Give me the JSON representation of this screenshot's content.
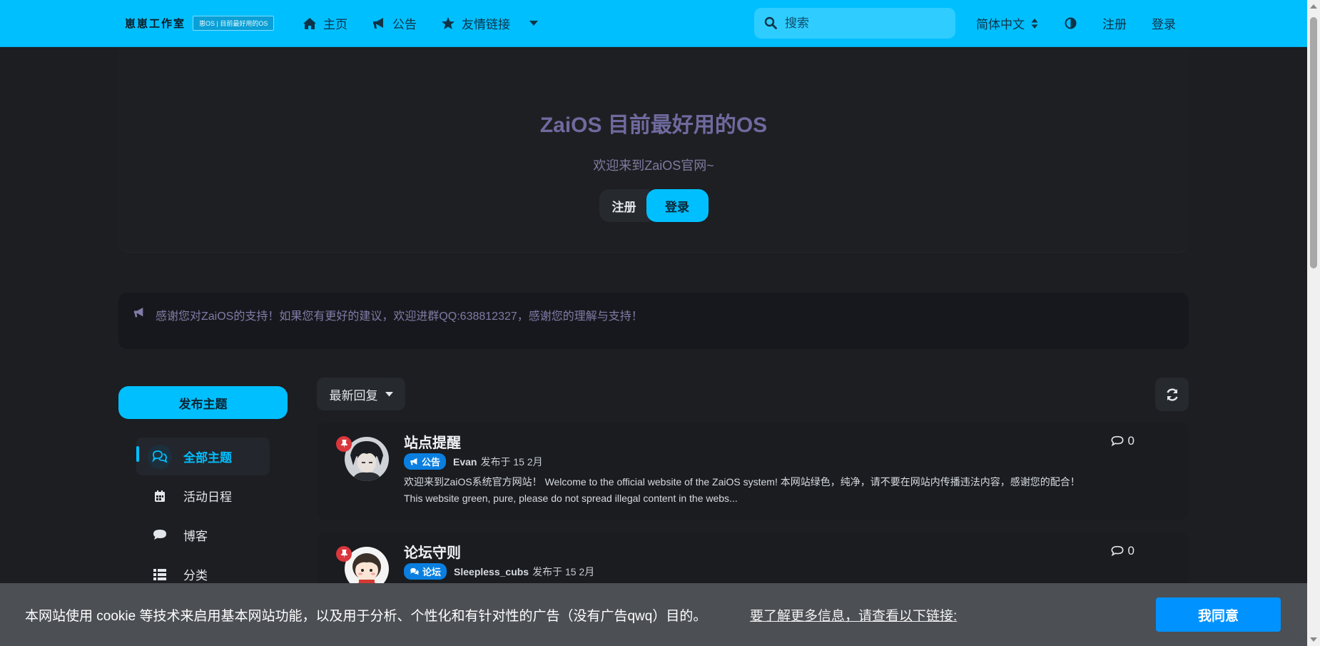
{
  "header": {
    "logo_text": "崽崽工作室",
    "logo_tag": "崽OS | 目前最好用的OS",
    "nav": [
      {
        "label": "主页",
        "icon": "home-icon"
      },
      {
        "label": "公告",
        "icon": "bullhorn-icon"
      },
      {
        "label": "友情链接",
        "icon": "star-icon"
      }
    ],
    "search_placeholder": "搜索",
    "language": "简体中文",
    "register": "注册",
    "login": "登录"
  },
  "hero": {
    "title": "ZaiOS 目前最好用的OS",
    "subtitle": "欢迎来到ZaiOS官网~",
    "register_button": "注册",
    "login_button": "登录"
  },
  "announcement": {
    "text": "感谢您对ZaiOS的支持！如果您有更好的建议，欢迎进群QQ:638812327，感谢您的理解与支持！"
  },
  "sidebar": {
    "start_button": "发布主题",
    "items": [
      {
        "label": "全部主题",
        "icon": "comments-icon",
        "active": true
      },
      {
        "label": "活动日程",
        "icon": "calendar-icon",
        "active": false
      },
      {
        "label": "博客",
        "icon": "comment-icon",
        "active": false
      },
      {
        "label": "分类",
        "icon": "list-icon",
        "active": false
      }
    ]
  },
  "toolbar": {
    "sort_label": "最新回复"
  },
  "discussions": [
    {
      "title": "站点提醒",
      "tag": "公告",
      "author": "Evan",
      "posted": "发布于 15 2月",
      "excerpt": "欢迎来到ZaiOS系统官方网站！ Welcome to the official website of the ZaiOS system! 本网站绿色，纯净，请不要在网站内传播违法内容，感谢您的配合！ This website green, pure, please do not spread illegal content in the webs...",
      "replies": "0",
      "colors": {
        "tag": "#0a7fe0"
      }
    },
    {
      "title": "论坛守则",
      "tag": "论坛",
      "author": "Sleepless_cubs",
      "posted": "发布于 15 2月",
      "excerpt": "",
      "replies": "0",
      "colors": {
        "tag": "#0a7fe0"
      }
    }
  ],
  "cookie": {
    "text": "本网站使用 cookie 等技术来启用基本网站功能，以及用于分析、个性化和有针对性的广告（没有广告qwq）目的。",
    "link": "要了解更多信息，请查看以下链接:",
    "accept": "我同意"
  },
  "colors": {
    "accent": "#00bfff",
    "background": "#1c1e22",
    "pin": "#d9373c",
    "cookie_button": "#0092ff"
  }
}
